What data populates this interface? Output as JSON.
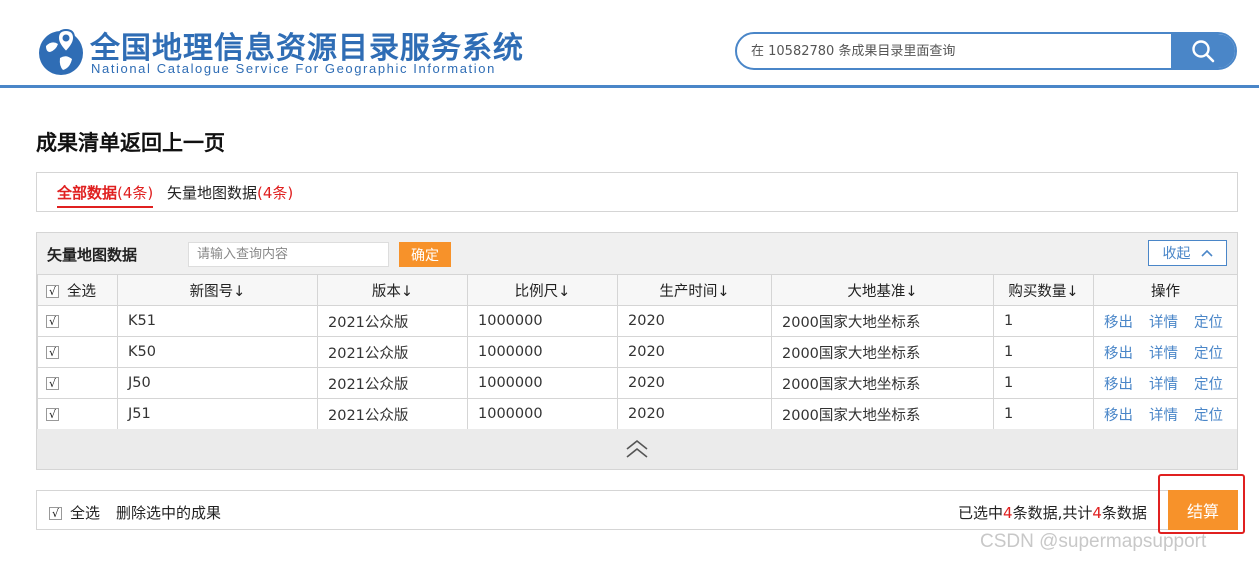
{
  "header": {
    "title": "全国地理信息资源目录服务系统",
    "subtitle": "National Catalogue Service For Geographic Information",
    "search_placeholder": "在 10582780 条成果目录里面查询",
    "brand_color": "#2f6db5"
  },
  "page": {
    "title": "成果清单返回上一页"
  },
  "tabs": [
    {
      "label": "全部数据",
      "count": "(4条)",
      "active": true
    },
    {
      "label": "矢量地图数据",
      "count": "(4条)",
      "active": false
    }
  ],
  "panel": {
    "title": "矢量地图数据",
    "filter_placeholder": "请输入查询内容",
    "confirm_label": "确定",
    "collapse_label": "收起"
  },
  "table": {
    "select_all": "全选",
    "headers": [
      "新图号↓",
      "版本↓",
      "比例尺↓",
      "生产时间↓",
      "大地基准↓",
      "购买数量↓",
      "操作"
    ],
    "rows": [
      {
        "checked": "√",
        "sheet": "K51",
        "edition": "2021公众版",
        "scale": "1000000",
        "year": "2020",
        "datum": "2000国家大地坐标系",
        "qty": "1"
      },
      {
        "checked": "√",
        "sheet": "K50",
        "edition": "2021公众版",
        "scale": "1000000",
        "year": "2020",
        "datum": "2000国家大地坐标系",
        "qty": "1"
      },
      {
        "checked": "√",
        "sheet": "J50",
        "edition": "2021公众版",
        "scale": "1000000",
        "year": "2020",
        "datum": "2000国家大地坐标系",
        "qty": "1"
      },
      {
        "checked": "√",
        "sheet": "J51",
        "edition": "2021公众版",
        "scale": "1000000",
        "year": "2020",
        "datum": "2000国家大地坐标系",
        "qty": "1"
      }
    ],
    "actions": [
      "移出",
      "详情",
      "定位"
    ]
  },
  "footer": {
    "check_mark": "√",
    "select_all": "全选",
    "delete_label": "删除选中的成果",
    "selected_prefix": "已选中",
    "selected_count": "4",
    "selected_mid": "条数据,共计",
    "total_count": "4",
    "selected_suffix": "条数据",
    "checkout_label": "结算"
  },
  "watermark": "CSDN @supermapsupport",
  "colors": {
    "accent": "#4a86c8",
    "orange": "#f7922a",
    "red": "#e02020"
  }
}
